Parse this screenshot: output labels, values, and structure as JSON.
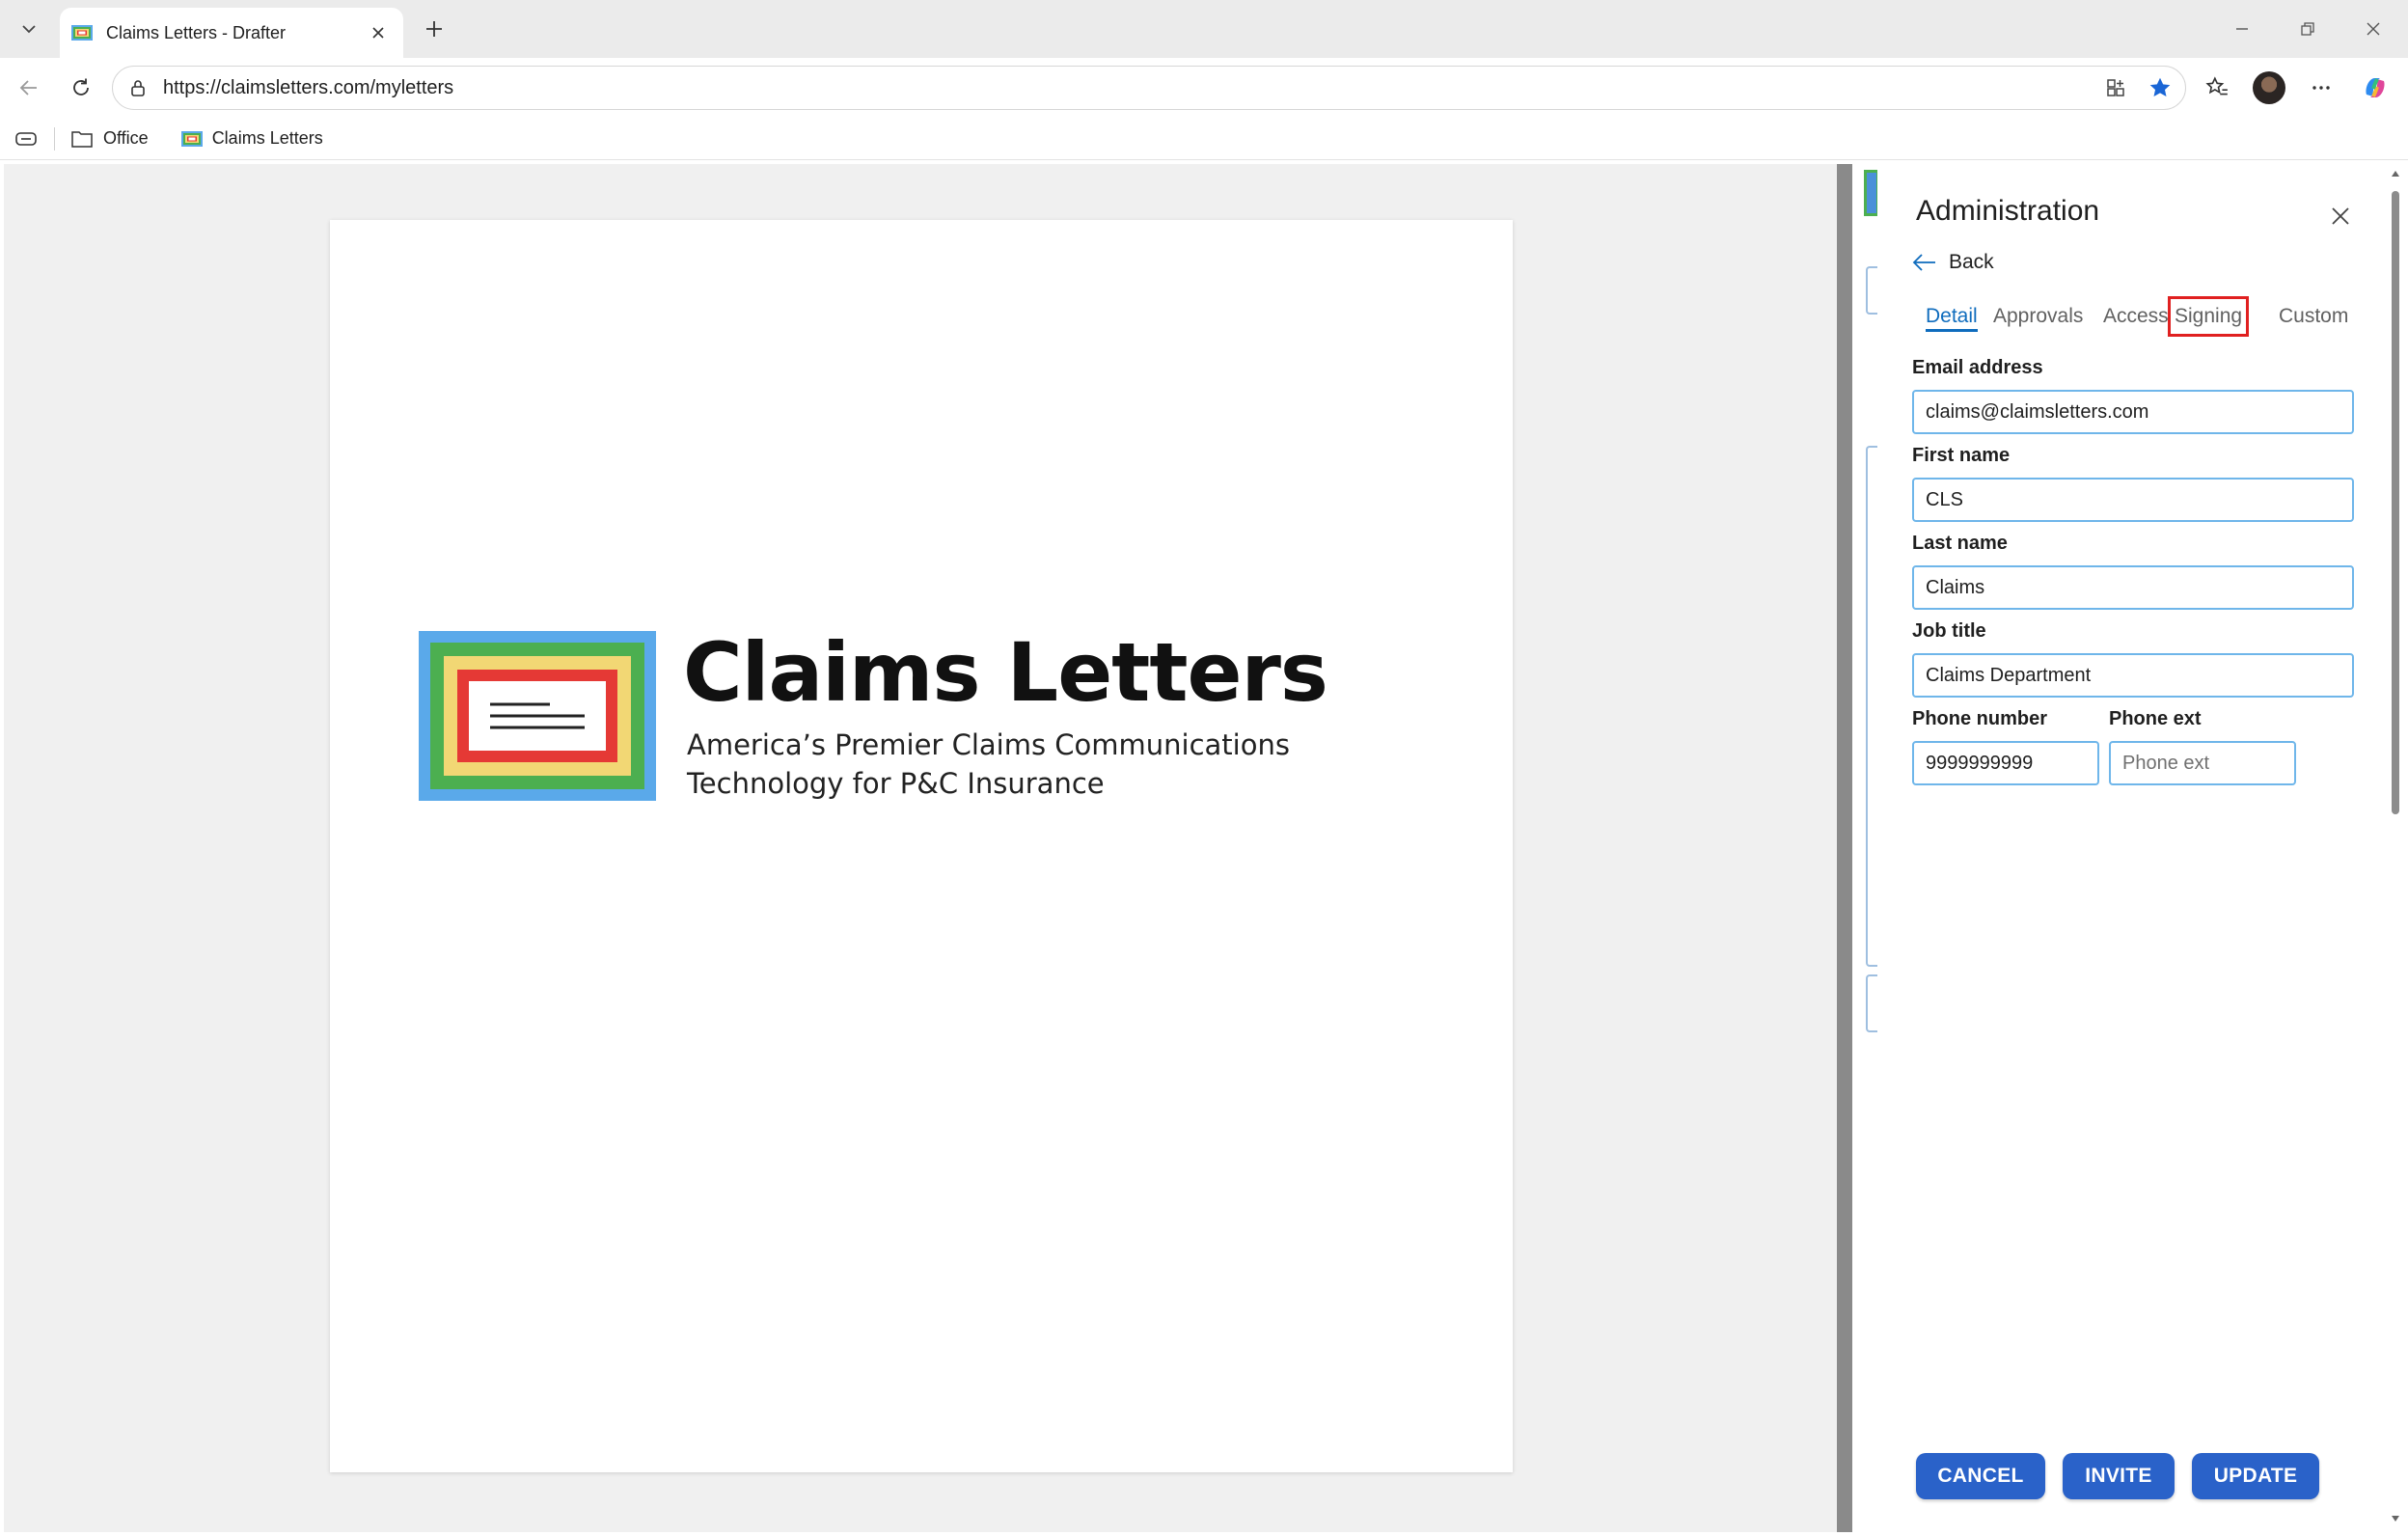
{
  "browser": {
    "tab": {
      "title": "Claims Letters - Drafter"
    },
    "address": {
      "url": "https://claimsletters.com/myletters"
    },
    "bookmarks": [
      {
        "label": "Office",
        "icon": "folder-icon"
      },
      {
        "label": "Claims Letters",
        "icon": "claims-letters-favicon"
      }
    ]
  },
  "document": {
    "brand_name": "Claims Letters",
    "tagline_line1": "America’s Premier Claims Communications",
    "tagline_line2": "Technology for P&C Insurance",
    "logo_colors": {
      "outer": "#5aa9ea",
      "ring1": "#4caf50",
      "ring2": "#f2d774",
      "ring3": "#e53935",
      "inner": "#ffffff"
    }
  },
  "admin_panel": {
    "title": "Administration",
    "back_label": "Back",
    "tabs": [
      {
        "label": "Detail",
        "active": true
      },
      {
        "label": "Approvals",
        "active": false
      },
      {
        "label": "Access",
        "active": false
      },
      {
        "label": "Signing",
        "active": false,
        "highlighted": true
      },
      {
        "label": "Custom",
        "active": false
      }
    ],
    "fields": {
      "email": {
        "label": "Email address",
        "value": "claims@claimsletters.com"
      },
      "first_name": {
        "label": "First name",
        "value": "CLS"
      },
      "last_name": {
        "label": "Last name",
        "value": "Claims"
      },
      "job_title": {
        "label": "Job title",
        "value": "Claims Department"
      },
      "phone": {
        "label": "Phone number",
        "value": "9999999999"
      },
      "phone_ext": {
        "label": "Phone ext",
        "value": "",
        "placeholder": "Phone ext"
      }
    },
    "buttons": {
      "cancel": "CANCEL",
      "invite": "INVITE",
      "update": "UPDATE"
    },
    "accent_color": "#0f6cbd",
    "button_color": "#2a62c9",
    "highlight_color": "#e02020"
  }
}
